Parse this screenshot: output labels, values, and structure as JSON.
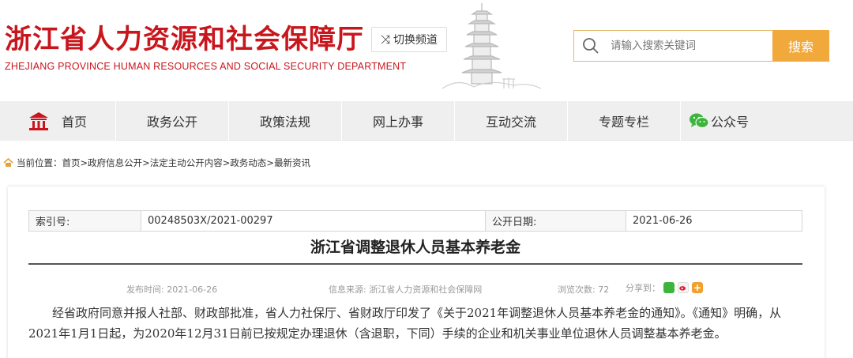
{
  "header": {
    "title_cn": "浙江省人力资源和社会保障厅",
    "title_en": "ZHEJIANG PROVINCE HUMAN RESOURCES AND SOCIAL SECURITY DEPARTMENT",
    "switch_label": "切换频道",
    "search_placeholder": "请输入搜索关键词",
    "search_button": "搜索",
    "brand_color": "#c8161d",
    "accent_color": "#f2a93b"
  },
  "nav": {
    "items": [
      {
        "label": "首页",
        "icon": "home-icon"
      },
      {
        "label": "政务公开"
      },
      {
        "label": "政策法规"
      },
      {
        "label": "网上办事"
      },
      {
        "label": "互动交流"
      },
      {
        "label": "专题专栏"
      },
      {
        "label": "公众号",
        "icon": "wechat-icon"
      }
    ]
  },
  "breadcrumb": {
    "prefix": "当前位置：",
    "path": [
      "首页",
      "政府信息公开",
      "法定主动公开内容",
      "政务动态",
      "最新资讯"
    ],
    "separator": " > "
  },
  "article": {
    "index_label": "索引号:",
    "index_value": "00248503X/2021-00297",
    "date_label": "公开日期:",
    "date_value": "2021-06-26",
    "title": "浙江省调整退休人员基本养老金",
    "publish_time": "发布时间: 2021-06-26",
    "source": "信息来源: 浙江省人力资源和社会保障网",
    "views": "浏览次数: 72",
    "share_label": "分享到：",
    "share_icons": [
      "wechat-share-icon",
      "weibo-share-icon",
      "plus-share-icon"
    ],
    "paragraph": "经省政府同意并报人社部、财政部批准，省人力社保厅、省财政厅印发了《关于2021年调整退休人员基本养老金的通知》。《通知》明确，从2021年1月1日起，为2020年12月31日前已按规定办理退休（含退职，下同）手续的企业和机关事业单位退休人员调整基本养老金。"
  }
}
